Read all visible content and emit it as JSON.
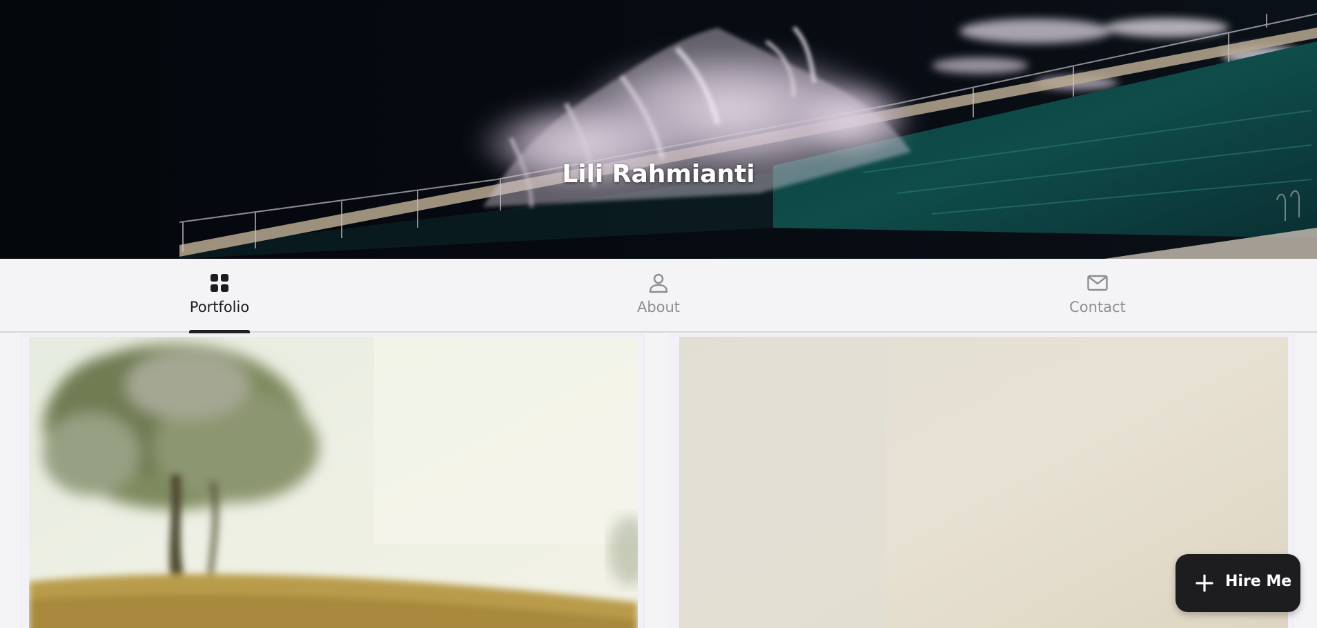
{
  "header": {
    "title": "Lili Rahmianti"
  },
  "tabs": [
    {
      "label": "Portfolio",
      "icon": "grid-icon",
      "active": true
    },
    {
      "label": "About",
      "icon": "person-icon",
      "active": false
    },
    {
      "label": "Contact",
      "icon": "mail-icon",
      "active": false
    }
  ],
  "fab": {
    "label": "Hire Me",
    "icon": "plus-icon"
  },
  "colors": {
    "active_text": "#1c1c1e",
    "inactive_text": "#8d8d92",
    "fab_bg": "#1d1d1f",
    "page_bg": "#f4f4f6"
  }
}
